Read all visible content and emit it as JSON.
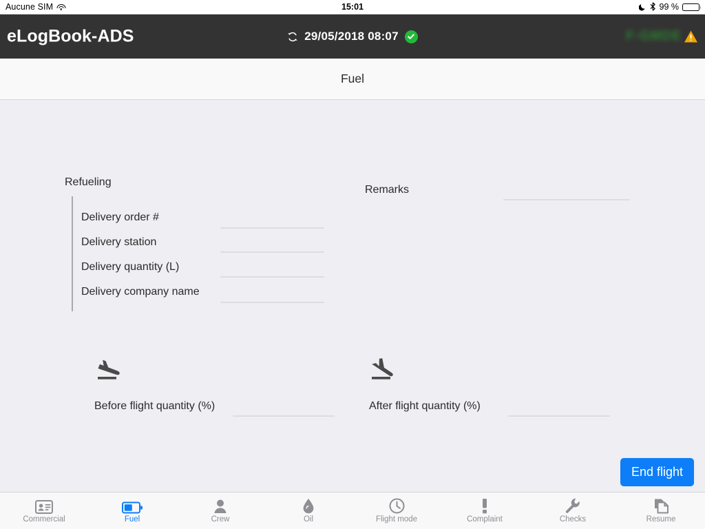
{
  "statusbar": {
    "carrier": "Aucune SIM",
    "wifi_icon": "wifi-icon",
    "time": "15:01",
    "dnd_icon": "moon-icon",
    "bluetooth_icon": "bluetooth-icon",
    "battery_percent": "99 %",
    "battery_icon": "battery-icon"
  },
  "header": {
    "app_title": "eLogBook-ADS",
    "sync_icon": "sync-icon",
    "sync_datetime": "29/05/2018 08:07",
    "sync_status_icon": "check-circle-icon",
    "aircraft_registration": "F-GMDE",
    "warning_icon": "warning-triangle-icon",
    "background_color": "#333333",
    "status_ok_color": "#24b83a",
    "warning_color": "#f0a500"
  },
  "subheader": {
    "title": "Fuel"
  },
  "form": {
    "refueling": {
      "section_label": "Refueling",
      "fields": [
        {
          "label": "Delivery order #",
          "value": "",
          "placeholder": ""
        },
        {
          "label": "Delivery station",
          "value": "",
          "placeholder": ""
        },
        {
          "label": "Delivery quantity (L)",
          "value": "",
          "placeholder": ""
        },
        {
          "label": "Delivery company name",
          "value": "",
          "placeholder": ""
        }
      ]
    },
    "remarks": {
      "label": "Remarks",
      "value": "",
      "placeholder": ""
    },
    "before_flight": {
      "icon": "airplane-takeoff-icon",
      "label": "Before flight quantity (%)",
      "value": "",
      "placeholder": ""
    },
    "after_flight": {
      "icon": "airplane-landing-icon",
      "label": "After flight quantity (%)",
      "value": "",
      "placeholder": ""
    }
  },
  "actions": {
    "end_flight_label": "End flight",
    "end_flight_color": "#0d7ef7"
  },
  "tabbar": {
    "active_index": 1,
    "active_color": "#0d7ef7",
    "inactive_color": "#8e8e93",
    "items": [
      {
        "label": "Commercial",
        "icon": "id-card-icon"
      },
      {
        "label": "Fuel",
        "icon": "battery-icon"
      },
      {
        "label": "Crew",
        "icon": "person-icon"
      },
      {
        "label": "Oil",
        "icon": "droplet-icon"
      },
      {
        "label": "Flight mode",
        "icon": "clock-icon"
      },
      {
        "label": "Complaint",
        "icon": "exclamation-icon"
      },
      {
        "label": "Checks",
        "icon": "wrench-icon"
      },
      {
        "label": "Resume",
        "icon": "documents-icon"
      }
    ]
  }
}
